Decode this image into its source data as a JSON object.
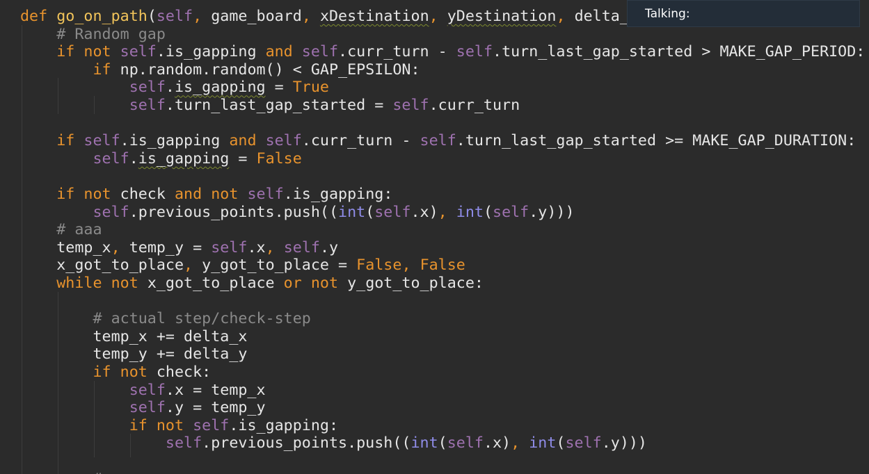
{
  "tooltip": {
    "text": "Talking:"
  },
  "colors": {
    "background": "#2b2b2b",
    "keyword": "#e8932d",
    "self": "#9f72b0",
    "comment": "#8a8a8a",
    "function_name": "#f2c45a",
    "builtin": "#8f8ce8",
    "default": "#e6e6e6",
    "tooltip_bg": "#232d38"
  },
  "code": {
    "lines": [
      {
        "tokens": [
          {
            "t": "def ",
            "c": "kw"
          },
          {
            "t": "go_on_path",
            "c": "fn"
          },
          {
            "t": "(",
            "c": "df"
          },
          {
            "t": "self",
            "c": "slf"
          },
          {
            "t": ", ",
            "c": "pu"
          },
          {
            "t": "game_board",
            "c": "df"
          },
          {
            "t": ", ",
            "c": "pu"
          },
          {
            "t": "xDestination",
            "c": "df",
            "s": 1
          },
          {
            "t": ", ",
            "c": "pu"
          },
          {
            "t": "yDestination",
            "c": "df",
            "s": 1
          },
          {
            "t": ", ",
            "c": "pu"
          },
          {
            "t": "delta_",
            "c": "df"
          }
        ]
      },
      {
        "tokens": [
          {
            "t": "    "
          },
          {
            "t": "# Random gap",
            "c": "cmt"
          }
        ]
      },
      {
        "tokens": [
          {
            "t": "    "
          },
          {
            "t": "if ",
            "c": "kw"
          },
          {
            "t": "not ",
            "c": "kw"
          },
          {
            "t": "self",
            "c": "slf"
          },
          {
            "t": ".is_gapping ",
            "c": "df"
          },
          {
            "t": "and ",
            "c": "kw"
          },
          {
            "t": "self",
            "c": "slf"
          },
          {
            "t": ".curr_turn - ",
            "c": "df"
          },
          {
            "t": "self",
            "c": "slf"
          },
          {
            "t": ".turn_last_gap_started > MAKE_GAP_PERIOD:",
            "c": "df"
          }
        ]
      },
      {
        "tokens": [
          {
            "t": "        "
          },
          {
            "t": "if ",
            "c": "kw"
          },
          {
            "t": "np.random.random() < GAP_EPSILON:",
            "c": "df"
          }
        ]
      },
      {
        "tokens": [
          {
            "t": "            "
          },
          {
            "t": "self",
            "c": "slf"
          },
          {
            "t": ".",
            "c": "df"
          },
          {
            "t": "is_gapping",
            "c": "df",
            "s": 1
          },
          {
            "t": " = ",
            "c": "df"
          },
          {
            "t": "True",
            "c": "kw"
          }
        ]
      },
      {
        "tokens": [
          {
            "t": "            "
          },
          {
            "t": "self",
            "c": "slf"
          },
          {
            "t": ".turn_last_gap_started = ",
            "c": "df"
          },
          {
            "t": "self",
            "c": "slf"
          },
          {
            "t": ".curr_turn",
            "c": "df"
          }
        ]
      },
      {
        "tokens": []
      },
      {
        "tokens": [
          {
            "t": "    "
          },
          {
            "t": "if ",
            "c": "kw"
          },
          {
            "t": "self",
            "c": "slf"
          },
          {
            "t": ".is_gapping ",
            "c": "df"
          },
          {
            "t": "and ",
            "c": "kw"
          },
          {
            "t": "self",
            "c": "slf"
          },
          {
            "t": ".curr_turn - ",
            "c": "df"
          },
          {
            "t": "self",
            "c": "slf"
          },
          {
            "t": ".turn_last_gap_started >= MAKE_GAP_DURATION:",
            "c": "df"
          }
        ]
      },
      {
        "tokens": [
          {
            "t": "        "
          },
          {
            "t": "self",
            "c": "slf"
          },
          {
            "t": ".",
            "c": "df"
          },
          {
            "t": "is_gapping",
            "c": "df",
            "s": 1
          },
          {
            "t": " = ",
            "c": "df"
          },
          {
            "t": "False",
            "c": "kw"
          }
        ]
      },
      {
        "tokens": []
      },
      {
        "tokens": [
          {
            "t": "    "
          },
          {
            "t": "if ",
            "c": "kw"
          },
          {
            "t": "not ",
            "c": "kw"
          },
          {
            "t": "check ",
            "c": "df"
          },
          {
            "t": "and ",
            "c": "kw"
          },
          {
            "t": "not ",
            "c": "kw"
          },
          {
            "t": "self",
            "c": "slf"
          },
          {
            "t": ".is_gapping:",
            "c": "df"
          }
        ]
      },
      {
        "tokens": [
          {
            "t": "        "
          },
          {
            "t": "self",
            "c": "slf"
          },
          {
            "t": ".previous_points.push((",
            "c": "df"
          },
          {
            "t": "int",
            "c": "bi"
          },
          {
            "t": "(",
            "c": "df"
          },
          {
            "t": "self",
            "c": "slf"
          },
          {
            "t": ".x)",
            "c": "df"
          },
          {
            "t": ", ",
            "c": "pu"
          },
          {
            "t": "int",
            "c": "bi"
          },
          {
            "t": "(",
            "c": "df"
          },
          {
            "t": "self",
            "c": "slf"
          },
          {
            "t": ".y)))",
            "c": "df"
          }
        ]
      },
      {
        "tokens": [
          {
            "t": "    "
          },
          {
            "t": "# aaa",
            "c": "cmt"
          }
        ]
      },
      {
        "tokens": [
          {
            "t": "    "
          },
          {
            "t": "temp_x",
            "c": "df"
          },
          {
            "t": ", ",
            "c": "pu"
          },
          {
            "t": "temp_y = ",
            "c": "df"
          },
          {
            "t": "self",
            "c": "slf"
          },
          {
            "t": ".x",
            "c": "df"
          },
          {
            "t": ", ",
            "c": "pu"
          },
          {
            "t": "self",
            "c": "slf"
          },
          {
            "t": ".y",
            "c": "df"
          }
        ]
      },
      {
        "tokens": [
          {
            "t": "    "
          },
          {
            "t": "x_got_to_place",
            "c": "df"
          },
          {
            "t": ", ",
            "c": "pu"
          },
          {
            "t": "y_got_to_place = ",
            "c": "df"
          },
          {
            "t": "False",
            "c": "kw"
          },
          {
            "t": ", ",
            "c": "pu"
          },
          {
            "t": "False",
            "c": "kw"
          }
        ]
      },
      {
        "tokens": [
          {
            "t": "    "
          },
          {
            "t": "while ",
            "c": "kw"
          },
          {
            "t": "not ",
            "c": "kw"
          },
          {
            "t": "x_got_to_place ",
            "c": "df"
          },
          {
            "t": "or ",
            "c": "kw"
          },
          {
            "t": "not ",
            "c": "kw"
          },
          {
            "t": "y_got_to_place:",
            "c": "df"
          }
        ]
      },
      {
        "tokens": []
      },
      {
        "tokens": [
          {
            "t": "        "
          },
          {
            "t": "# actual step/check-step",
            "c": "cmt"
          }
        ]
      },
      {
        "tokens": [
          {
            "t": "        "
          },
          {
            "t": "temp_x += delta_x",
            "c": "df"
          }
        ]
      },
      {
        "tokens": [
          {
            "t": "        "
          },
          {
            "t": "temp_y += delta_y",
            "c": "df"
          }
        ]
      },
      {
        "tokens": [
          {
            "t": "        "
          },
          {
            "t": "if ",
            "c": "kw"
          },
          {
            "t": "not ",
            "c": "kw"
          },
          {
            "t": "check:",
            "c": "df"
          }
        ]
      },
      {
        "tokens": [
          {
            "t": "            "
          },
          {
            "t": "self",
            "c": "slf"
          },
          {
            "t": ".x = temp_x",
            "c": "df"
          }
        ]
      },
      {
        "tokens": [
          {
            "t": "            "
          },
          {
            "t": "self",
            "c": "slf"
          },
          {
            "t": ".y = temp_y",
            "c": "df"
          }
        ]
      },
      {
        "tokens": [
          {
            "t": "            "
          },
          {
            "t": "if ",
            "c": "kw"
          },
          {
            "t": "not ",
            "c": "kw"
          },
          {
            "t": "self",
            "c": "slf"
          },
          {
            "t": ".is_gapping:",
            "c": "df"
          }
        ]
      },
      {
        "tokens": [
          {
            "t": "                "
          },
          {
            "t": "self",
            "c": "slf"
          },
          {
            "t": ".previous_points.push((",
            "c": "df"
          },
          {
            "t": "int",
            "c": "bi"
          },
          {
            "t": "(",
            "c": "df"
          },
          {
            "t": "self",
            "c": "slf"
          },
          {
            "t": ".x)",
            "c": "df"
          },
          {
            "t": ", ",
            "c": "pu"
          },
          {
            "t": "int",
            "c": "bi"
          },
          {
            "t": "(",
            "c": "df"
          },
          {
            "t": "self",
            "c": "slf"
          },
          {
            "t": ".y)))",
            "c": "df"
          }
        ]
      },
      {
        "tokens": []
      },
      {
        "tokens": [
          {
            "t": "        "
          },
          {
            "t": "#",
            "c": "cmt"
          }
        ]
      }
    ]
  }
}
